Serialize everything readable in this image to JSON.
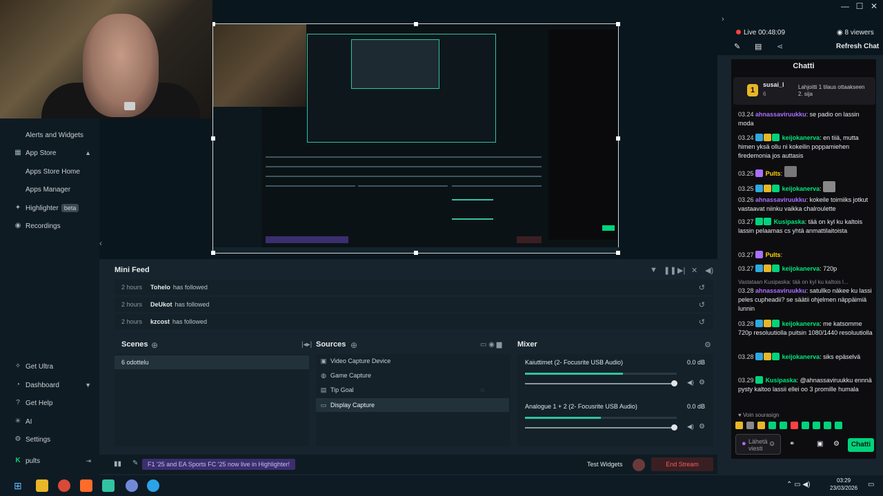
{
  "window": {
    "minimize": "—",
    "maximize": "☐",
    "close": "✕"
  },
  "sidebar": {
    "items": [
      {
        "label": "Alerts and Widgets"
      },
      {
        "label": "App Store"
      },
      {
        "label": "Apps Store Home"
      },
      {
        "label": "Apps Manager"
      },
      {
        "label": "Highlighter",
        "badge": "beta"
      },
      {
        "label": "Recordings"
      }
    ],
    "bottom": [
      {
        "label": "Get Ultra"
      },
      {
        "label": "Dashboard"
      },
      {
        "label": "Get Help"
      },
      {
        "label": "AI"
      },
      {
        "label": "Settings"
      },
      {
        "label": "pults"
      }
    ]
  },
  "minifeed": {
    "title": "Mini Feed",
    "rows": [
      {
        "time": "2 hours",
        "user": "Tohelo",
        "action": "has followed"
      },
      {
        "time": "2 hours",
        "user": "DeUkot",
        "action": "has followed"
      },
      {
        "time": "2 hours",
        "user": "kzcost",
        "action": "has followed"
      }
    ]
  },
  "scenes": {
    "title": "Scenes",
    "items": [
      "6 odottelu"
    ]
  },
  "sources": {
    "title": "Sources",
    "items": [
      {
        "label": "Video Capture Device",
        "icon": "camera-icon"
      },
      {
        "label": "Game Capture",
        "icon": "gamepad-icon"
      },
      {
        "label": "Tip Goal",
        "icon": "goal-icon"
      },
      {
        "label": "Display Capture",
        "icon": "monitor-icon"
      }
    ]
  },
  "mixer": {
    "title": "Mixer",
    "channels": [
      {
        "name": "Kaiuttimet (2- Focusrite USB Audio)",
        "db": "0.0 dB"
      },
      {
        "name": "Analogue 1 + 2 (2- Focusrite USB Audio)",
        "db": "0.0 dB"
      }
    ]
  },
  "bottombar": {
    "news": "F1 '25 and EA Sports FC '25 now live in Highlighter!",
    "test_widgets": "Test Widgets",
    "end_stream": "End Stream"
  },
  "chat": {
    "live": "Live 00:48:09",
    "viewers": "8 viewers",
    "refresh": "Refresh Chat",
    "title": "Chatti",
    "pinned_user": "susai_l",
    "pinned_count": "6",
    "pinned_text": "Lahjoitti 1 tilaus ottaakseen 2. sija",
    "messages": [
      {
        "ts": "03.24",
        "name": "ahnassaviruukku",
        "color": "purple",
        "text": ": se padio on lassin moda"
      },
      {
        "ts": "03.24",
        "name": "keijokanerva",
        "color": "green",
        "text": ": en tiiä, mutta himen yksä ollu ni kokeilin poppamiehen firedemonia jos auttasis"
      },
      {
        "ts": "03.25",
        "name": "Pults",
        "color": "yellow",
        "text": ":"
      },
      {
        "ts": "03.25",
        "name": "keijokanerva",
        "color": "green",
        "text": ":"
      },
      {
        "ts": "03.26",
        "name": "ahnassaviruukku",
        "color": "purple",
        "text": ": kokeile toimiiks jotkut vastaavat niinku vaikka chalroulette"
      },
      {
        "ts": "03.27",
        "name": "Kusipaska",
        "color": "green",
        "text": ": tää on kyl ku kaltois lassin pelaamas cs yhtä anmattilaitoista"
      },
      {
        "ts": "03.27",
        "name": "Pults",
        "color": "yellow",
        "text": ":"
      },
      {
        "ts": "03.27",
        "name": "keijokanerva",
        "color": "green",
        "text": ": 720p"
      },
      {
        "ts": "03.28",
        "name": "ahnassaviruukku",
        "color": "purple",
        "text": ": satullko näkee ku lassi peles cupheadii? se säätii ohjelmen näppäimiä lunnin",
        "reply": "Vastataan Kusipaska: tää on kyl ku kaltois l..."
      },
      {
        "ts": "03.28",
        "name": "keijokanerva",
        "color": "green",
        "text": ": me katsomme 720p resoluutiolla puitsin 1080/1440 resoluutiolla"
      },
      {
        "ts": "03.28",
        "name": "keijokanerva",
        "color": "green",
        "text": ": siks epäselvä"
      },
      {
        "ts": "03.29",
        "name": "Kusipaska",
        "color": "green",
        "text": ": @ahnassaviruukku ennnä pysty kaltoo lassii ellei oo 3 promille humala"
      }
    ],
    "reward_label": "Voin sourasign",
    "input_placeholder": "Lähetä viesti",
    "send": "Chatti"
  },
  "taskbar": {
    "time": "03:29",
    "date": "23/03/2026"
  },
  "colors": {
    "accent": "#31c3a2",
    "live": "#ff4040",
    "chat_green": "#00d37c",
    "end_stream": "#ff5a5f"
  }
}
